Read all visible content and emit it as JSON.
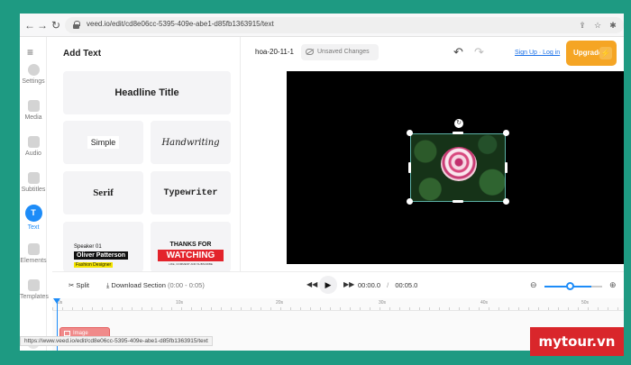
{
  "browser": {
    "url": "veed.io/edit/cd8e06cc-5395-409e-abe1-d85fb1363915/text",
    "back_icon": "arrow-left",
    "forward_icon": "arrow-right",
    "reload_icon": "reload"
  },
  "rail": {
    "items": [
      {
        "label": "Settings",
        "icon": "gear-icon"
      },
      {
        "label": "Media",
        "icon": "plus-icon"
      },
      {
        "label": "Audio",
        "icon": "music-icon"
      },
      {
        "label": "Subtitles",
        "icon": "subtitles-icon"
      },
      {
        "label": "Text",
        "icon": "text-icon",
        "glyph": "T"
      },
      {
        "label": "Elements",
        "icon": "elements-icon"
      },
      {
        "label": "Templates",
        "icon": "templates-icon"
      }
    ],
    "help": "?"
  },
  "panel": {
    "title": "Add Text",
    "headline": "Headline Title",
    "simple": "Simple",
    "handwriting": "Handwriting",
    "serif": "Serif",
    "typewriter": "Typewriter",
    "speaker": {
      "small": "Speaker 01",
      "name": "Oliver Patterson",
      "role": "Fashion Designer"
    },
    "thanks": {
      "top": "THANKS FOR",
      "main": "WATCHING",
      "sub": "LIKE, COMMENT AND SUBSCRIBE"
    }
  },
  "project": {
    "name": "hoa-20-11-1",
    "unsaved": "Unsaved Changes",
    "sign": "Sign Up · Log in",
    "upgrade": "Upgrade",
    "bolt": "⚡"
  },
  "controls": {
    "split": "Split",
    "download": "Download Section",
    "download_range": "(0:00 - 0:05)",
    "current_time": "00:00.0",
    "separator": "/",
    "total_time": "00:05.0",
    "zoom_level": 0.55
  },
  "timeline": {
    "ticks": [
      "0s",
      "10s",
      "20s",
      "30s",
      "40s",
      "50s"
    ],
    "track_label": "Image"
  },
  "status_url": "https://www.veed.io/edit/cd8e06cc-5395-409e-abe1-d85fb1363915/text",
  "watermark": "mytour.vn",
  "colors": {
    "accent": "#1d8cf8",
    "upgrade": "#f5a524",
    "track": "#f08a8a",
    "watermark": "#d9262b",
    "background": "#1e9a82"
  }
}
